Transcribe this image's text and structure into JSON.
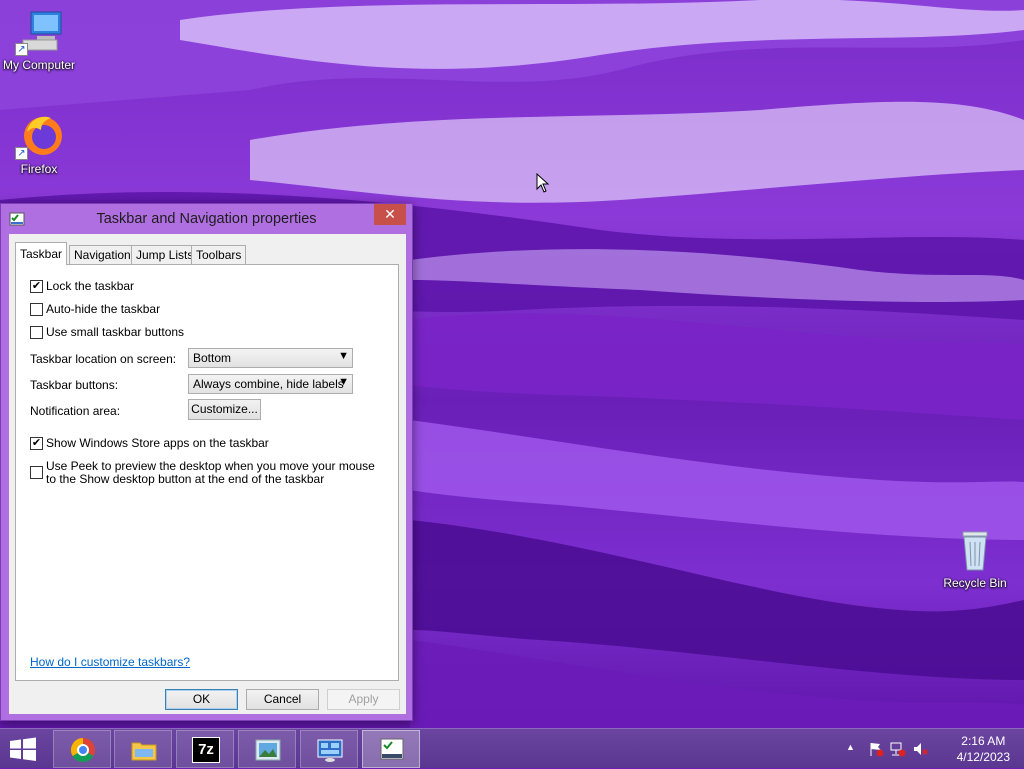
{
  "desktop": {
    "icons": [
      {
        "label": "My Computer"
      },
      {
        "label": "Firefox"
      },
      {
        "label": "Recycle Bin"
      }
    ]
  },
  "dialog": {
    "title": "Taskbar and Navigation properties",
    "close_label": "✕",
    "tabs": [
      {
        "label": "Taskbar",
        "active": true
      },
      {
        "label": "Navigation",
        "active": false
      },
      {
        "label": "Jump Lists",
        "active": false
      },
      {
        "label": "Toolbars",
        "active": false
      }
    ],
    "options": {
      "lock_taskbar": {
        "label": "Lock the taskbar",
        "checked": true
      },
      "auto_hide": {
        "label": "Auto-hide the taskbar",
        "checked": false
      },
      "small_buttons": {
        "label": "Use small taskbar buttons",
        "checked": false
      },
      "store_apps": {
        "label": "Show Windows Store apps on the taskbar",
        "checked": true
      },
      "peek": {
        "label": "Use Peek to preview the desktop when you move your mouse to the Show desktop button at the end of the taskbar",
        "checked": false
      }
    },
    "location": {
      "label": "Taskbar location on screen:",
      "value": "Bottom"
    },
    "buttons_setting": {
      "label": "Taskbar buttons:",
      "value": "Always combine, hide labels"
    },
    "notification": {
      "label": "Notification area:",
      "button": "Customize..."
    },
    "help_link": "How do I customize taskbars?",
    "ok": "OK",
    "cancel": "Cancel",
    "apply": "Apply"
  },
  "taskbar": {
    "apps": [
      {
        "icon": "chrome-icon"
      },
      {
        "icon": "file-explorer-icon"
      },
      {
        "icon": "7zip-icon",
        "text": "7z"
      },
      {
        "icon": "photo-viewer-icon"
      },
      {
        "icon": "control-panel-icon"
      },
      {
        "icon": "taskbar-properties-icon"
      }
    ],
    "clock": {
      "time": "2:16 AM",
      "date": "4/12/2023"
    }
  },
  "colors": {
    "accent": "#b06fe0",
    "taskbar": "#5a3790",
    "link": "#0066cc",
    "close": "#c7504a"
  }
}
